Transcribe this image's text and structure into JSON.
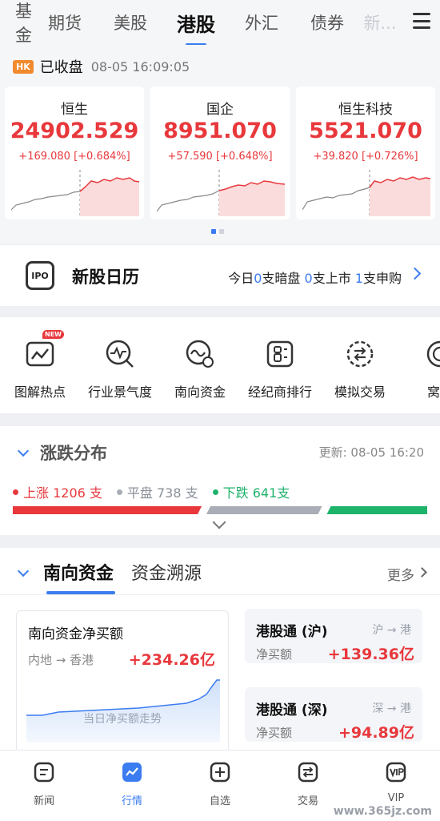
{
  "top_tabs": {
    "items": [
      "基金",
      "期货",
      "美股",
      "港股",
      "外汇",
      "债券",
      "新..."
    ],
    "first_visible": "基金",
    "active": "港股"
  },
  "market": {
    "badge": "HK",
    "status": "已收盘",
    "time": "08-05 16:09:05",
    "indices": [
      {
        "name": "恒生",
        "value": "24902.529",
        "change": "+169.080 [+0.684%]"
      },
      {
        "name": "国企",
        "value": "8951.070",
        "change": "+57.590 [+0.648%]"
      },
      {
        "name": "恒生科技",
        "value": "5521.070",
        "change": "+39.820 [+0.726%]"
      }
    ]
  },
  "ipo": {
    "icon_text": "IPO",
    "title": "新股日历",
    "summary": {
      "p1": "今日",
      "n1": "0",
      "p2": "支暗盘 ",
      "n2": "0",
      "p3": "支上市 ",
      "n3": "1",
      "p4": "支申购"
    }
  },
  "shortcuts": [
    {
      "label": "图解热点",
      "icon": "chart-hot-icon",
      "badge": "NEW"
    },
    {
      "label": "行业景气度",
      "icon": "industry-pulse-icon"
    },
    {
      "label": "南向资金",
      "icon": "southbound-funds-icon"
    },
    {
      "label": "经纪商排行",
      "icon": "broker-rank-icon"
    },
    {
      "label": "模拟交易",
      "icon": "sim-trade-icon"
    },
    {
      "label": "窝轮",
      "icon": "warrant-icon"
    }
  ],
  "distribution": {
    "title": "涨跌分布",
    "update": "更新: 08-05 16:20",
    "up": "上涨 1206 支",
    "flat": "平盘 738 支",
    "down": "下跌 641支",
    "up_count": 1206,
    "flat_count": 738,
    "down_count": 641,
    "colors": {
      "up": "#e8383c",
      "flat": "#a9adb5",
      "down": "#1eb36b"
    }
  },
  "south": {
    "tab_active": "南向资金",
    "tab_other": "资金溯源",
    "more": "更多",
    "net_title": "南向资金净买额",
    "net_route": "内地 → 香港",
    "net_value": "+234.26亿",
    "net_caption": "当日净买额走势",
    "connects": [
      {
        "title": "港股通 (沪)",
        "dir": "沪 → 港",
        "label": "净买额",
        "value": "+139.36亿"
      },
      {
        "title": "港股通 (深)",
        "dir": "深 → 港",
        "label": "净买额",
        "value": "+94.89亿"
      }
    ]
  },
  "bottom_nav": [
    {
      "label": "新闻",
      "icon": "news-icon"
    },
    {
      "label": "行情",
      "icon": "market-icon"
    },
    {
      "label": "自选",
      "icon": "watchlist-icon"
    },
    {
      "label": "交易",
      "icon": "trade-icon"
    },
    {
      "label": "VIP",
      "icon": "vip-icon"
    }
  ],
  "bottom_nav_active": "行情",
  "watermark": "www.365jz.com"
}
